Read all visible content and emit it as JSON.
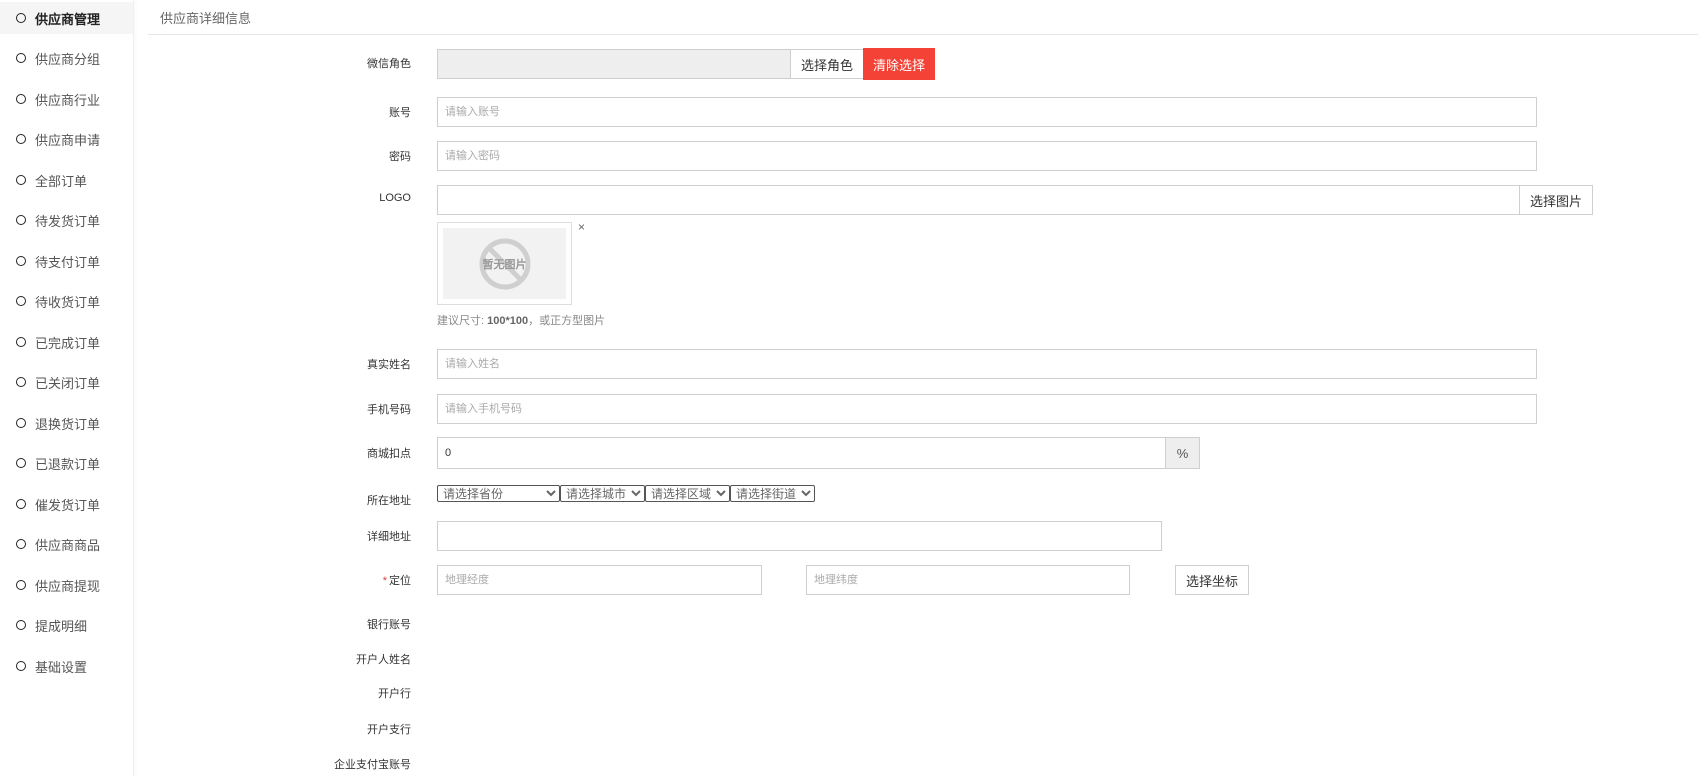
{
  "sidebar": {
    "items": [
      {
        "label": "供应商管理",
        "active": true
      },
      {
        "label": "供应商分组"
      },
      {
        "label": "供应商行业"
      },
      {
        "label": "供应商申请"
      },
      {
        "label": "全部订单"
      },
      {
        "label": "待发货订单"
      },
      {
        "label": "待支付订单"
      },
      {
        "label": "待收货订单"
      },
      {
        "label": "已完成订单"
      },
      {
        "label": "已关闭订单"
      },
      {
        "label": "退换货订单"
      },
      {
        "label": "已退款订单"
      },
      {
        "label": "催发货订单"
      },
      {
        "label": "供应商商品"
      },
      {
        "label": "供应商提现"
      },
      {
        "label": "提成明细"
      },
      {
        "label": "基础设置"
      }
    ]
  },
  "header": {
    "title": "供应商详细信息"
  },
  "form": {
    "wechat_role": {
      "label": "微信角色",
      "value": "",
      "choose_button": "选择角色",
      "clear_button": "清除选择"
    },
    "account": {
      "label": "账号",
      "placeholder": "请输入账号"
    },
    "password": {
      "label": "密码",
      "placeholder": "请输入密码"
    },
    "logo": {
      "label": "LOGO",
      "value": "",
      "choose_button": "选择图片",
      "no_image_text": "暂无图片",
      "remove": "×",
      "hint_prefix": "建议尺寸: ",
      "hint_size": "100*100",
      "hint_suffix": "，或正方型图片"
    },
    "real_name": {
      "label": "真实姓名",
      "placeholder": "请输入姓名"
    },
    "phone": {
      "label": "手机号码",
      "placeholder": "请输入手机号码"
    },
    "commission": {
      "label": "商城扣点",
      "value": "0",
      "unit": "%"
    },
    "address": {
      "label": "所在地址",
      "province": "请选择省份",
      "city": "请选择城市",
      "district": "请选择区域",
      "street": "请选择街道"
    },
    "detail_address": {
      "label": "详细地址",
      "value": ""
    },
    "location": {
      "required_mark": "*",
      "label": "定位",
      "lng_placeholder": "地理经度",
      "lat_placeholder": "地理纬度",
      "choose_button": "选择坐标"
    },
    "bank_account": {
      "label": "银行账号"
    },
    "account_holder": {
      "label": "开户人姓名"
    },
    "bank": {
      "label": "开户行"
    },
    "bank_branch": {
      "label": "开户支行"
    },
    "alipay": {
      "label": "企业支付宝账号"
    }
  },
  "colors": {
    "danger": "#f44336",
    "addon_bg": "#eeeeee",
    "border": "#cfcfcf"
  }
}
